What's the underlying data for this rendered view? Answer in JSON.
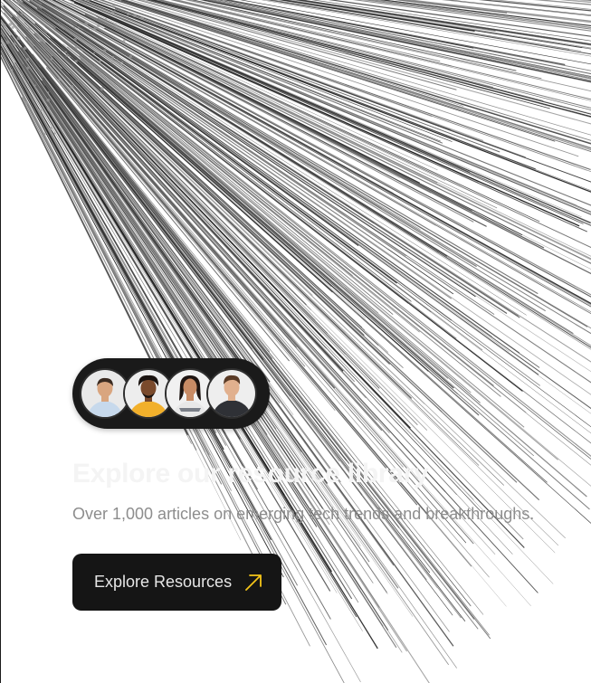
{
  "hero": {
    "headline": "Explore our resource library",
    "subline": "Over 1,000 articles on emerging tech trends and breakthroughs.",
    "cta_label": "Explore Resources",
    "cta_icon": "arrow-up-right-icon"
  },
  "avatars": [
    {
      "name": "avatar-1",
      "shirt": "#c7d9ec",
      "skin": "#d9a57f",
      "hair": "#3a2a20",
      "bg": "#e9e9e9"
    },
    {
      "name": "avatar-2",
      "shirt": "#f2b02b",
      "skin": "#7a4a2c",
      "hair": "#1a1310",
      "bg": "#ededed"
    },
    {
      "name": "avatar-3",
      "shirt": "#e8e8e8",
      "skin": "#c88b65",
      "hair": "#1e1512",
      "bg": "#f1f1f1"
    },
    {
      "name": "avatar-4",
      "shirt": "#2f3136",
      "skin": "#e1b08e",
      "hair": "#5a3b26",
      "bg": "#eeeeee"
    }
  ],
  "colors": {
    "background": "#ffffff",
    "pill": "#1a1a1a",
    "button": "#151515",
    "accent_arrow": "#f5c518",
    "subtext": "#8d8d8d"
  }
}
